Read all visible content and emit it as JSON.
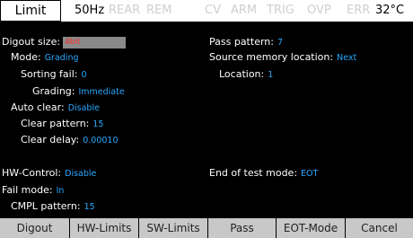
{
  "status_bar": {
    "mode": "Limit",
    "frequency": "50Hz",
    "flags": [
      "REAR",
      "REM",
      "CV",
      "ARM",
      "TRIG",
      "OVP",
      "ERR"
    ],
    "temperature": "32°C"
  },
  "settings": {
    "digout_size": {
      "label": "Digout size:",
      "value": "4bit"
    },
    "mode": {
      "label": "Mode:",
      "value": "Grading"
    },
    "sorting_fail": {
      "label": "Sorting fail:",
      "value": "0"
    },
    "grading": {
      "label": "Grading:",
      "value": "Immediate"
    },
    "auto_clear": {
      "label": "Auto clear:",
      "value": "Disable"
    },
    "clear_pattern": {
      "label": "Clear pattern:",
      "value": "15"
    },
    "clear_delay": {
      "label": "Clear delay:",
      "value": "0.00010"
    },
    "hw_control": {
      "label": "HW-Control:",
      "value": "Disable"
    },
    "fail_mode": {
      "label": "Fail mode:",
      "value": "In"
    },
    "cmpl_pattern": {
      "label": "CMPL pattern:",
      "value": "15"
    },
    "pass_pattern": {
      "label": "Pass pattern:",
      "value": "7"
    },
    "source_memory_location": {
      "label": "Source memory location:",
      "value": "Next"
    },
    "location": {
      "label": "Location:",
      "value": "1"
    },
    "end_of_test_mode": {
      "label": "End of test mode:",
      "value": "EOT"
    }
  },
  "softkeys": [
    "Digout",
    "HW-Limits",
    "SW-Limits",
    "Pass",
    "EOT-Mode",
    "Cancel"
  ],
  "colors": {
    "background": "#000000",
    "value_text": "#2aa8ff",
    "alert_value": "#ff2a2a",
    "softkey_bg": "#c8c8c8",
    "status_dim": "#cfcfcf"
  }
}
